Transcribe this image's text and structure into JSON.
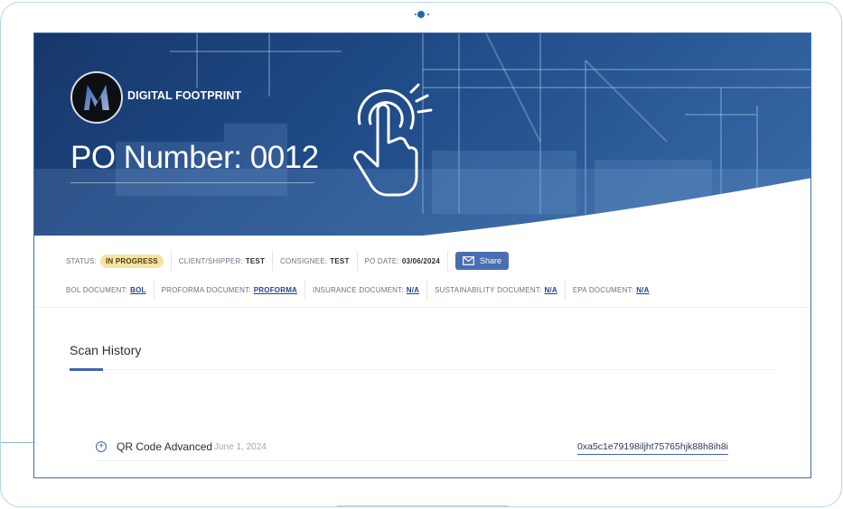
{
  "header": {
    "brand": "DIGITAL FOOTPRINT",
    "po_title": "PO Number: 0012"
  },
  "meta": {
    "status_label": "STATUS:",
    "status_value": "IN PROGRESS",
    "client_label": "CLIENT/SHIPPER:",
    "client_value": "TEST",
    "consignee_label": "CONSIGNEE:",
    "consignee_value": "TEST",
    "po_date_label": "PO DATE:",
    "po_date_value": "03/06/2024",
    "share_label": "Share",
    "bol_label": "BOL DOCUMENT:",
    "bol_value": "BOL",
    "proforma_label": "PROFORMA DOCUMENT:",
    "proforma_value": "PROFORMA",
    "insurance_label": "INSURANCE DOCUMENT:",
    "insurance_value": "N/A",
    "sustainability_label": "SUSTAINABILITY DOCUMENT:",
    "sustainability_value": "N/A",
    "epa_label": "EPA DOCUMENT:",
    "epa_value": "N/A"
  },
  "scan_history": {
    "title": "Scan History",
    "items": [
      {
        "name": "QR Code Advanced",
        "date": "June 1, 2024",
        "hash": "0xa5c1e79198iljht75765hjk88h8ih8i"
      }
    ]
  },
  "colors": {
    "hero": "#1f4a86",
    "accent": "#3f64ad",
    "badge": "#f6e2a3",
    "share": "#4a6eb2"
  }
}
